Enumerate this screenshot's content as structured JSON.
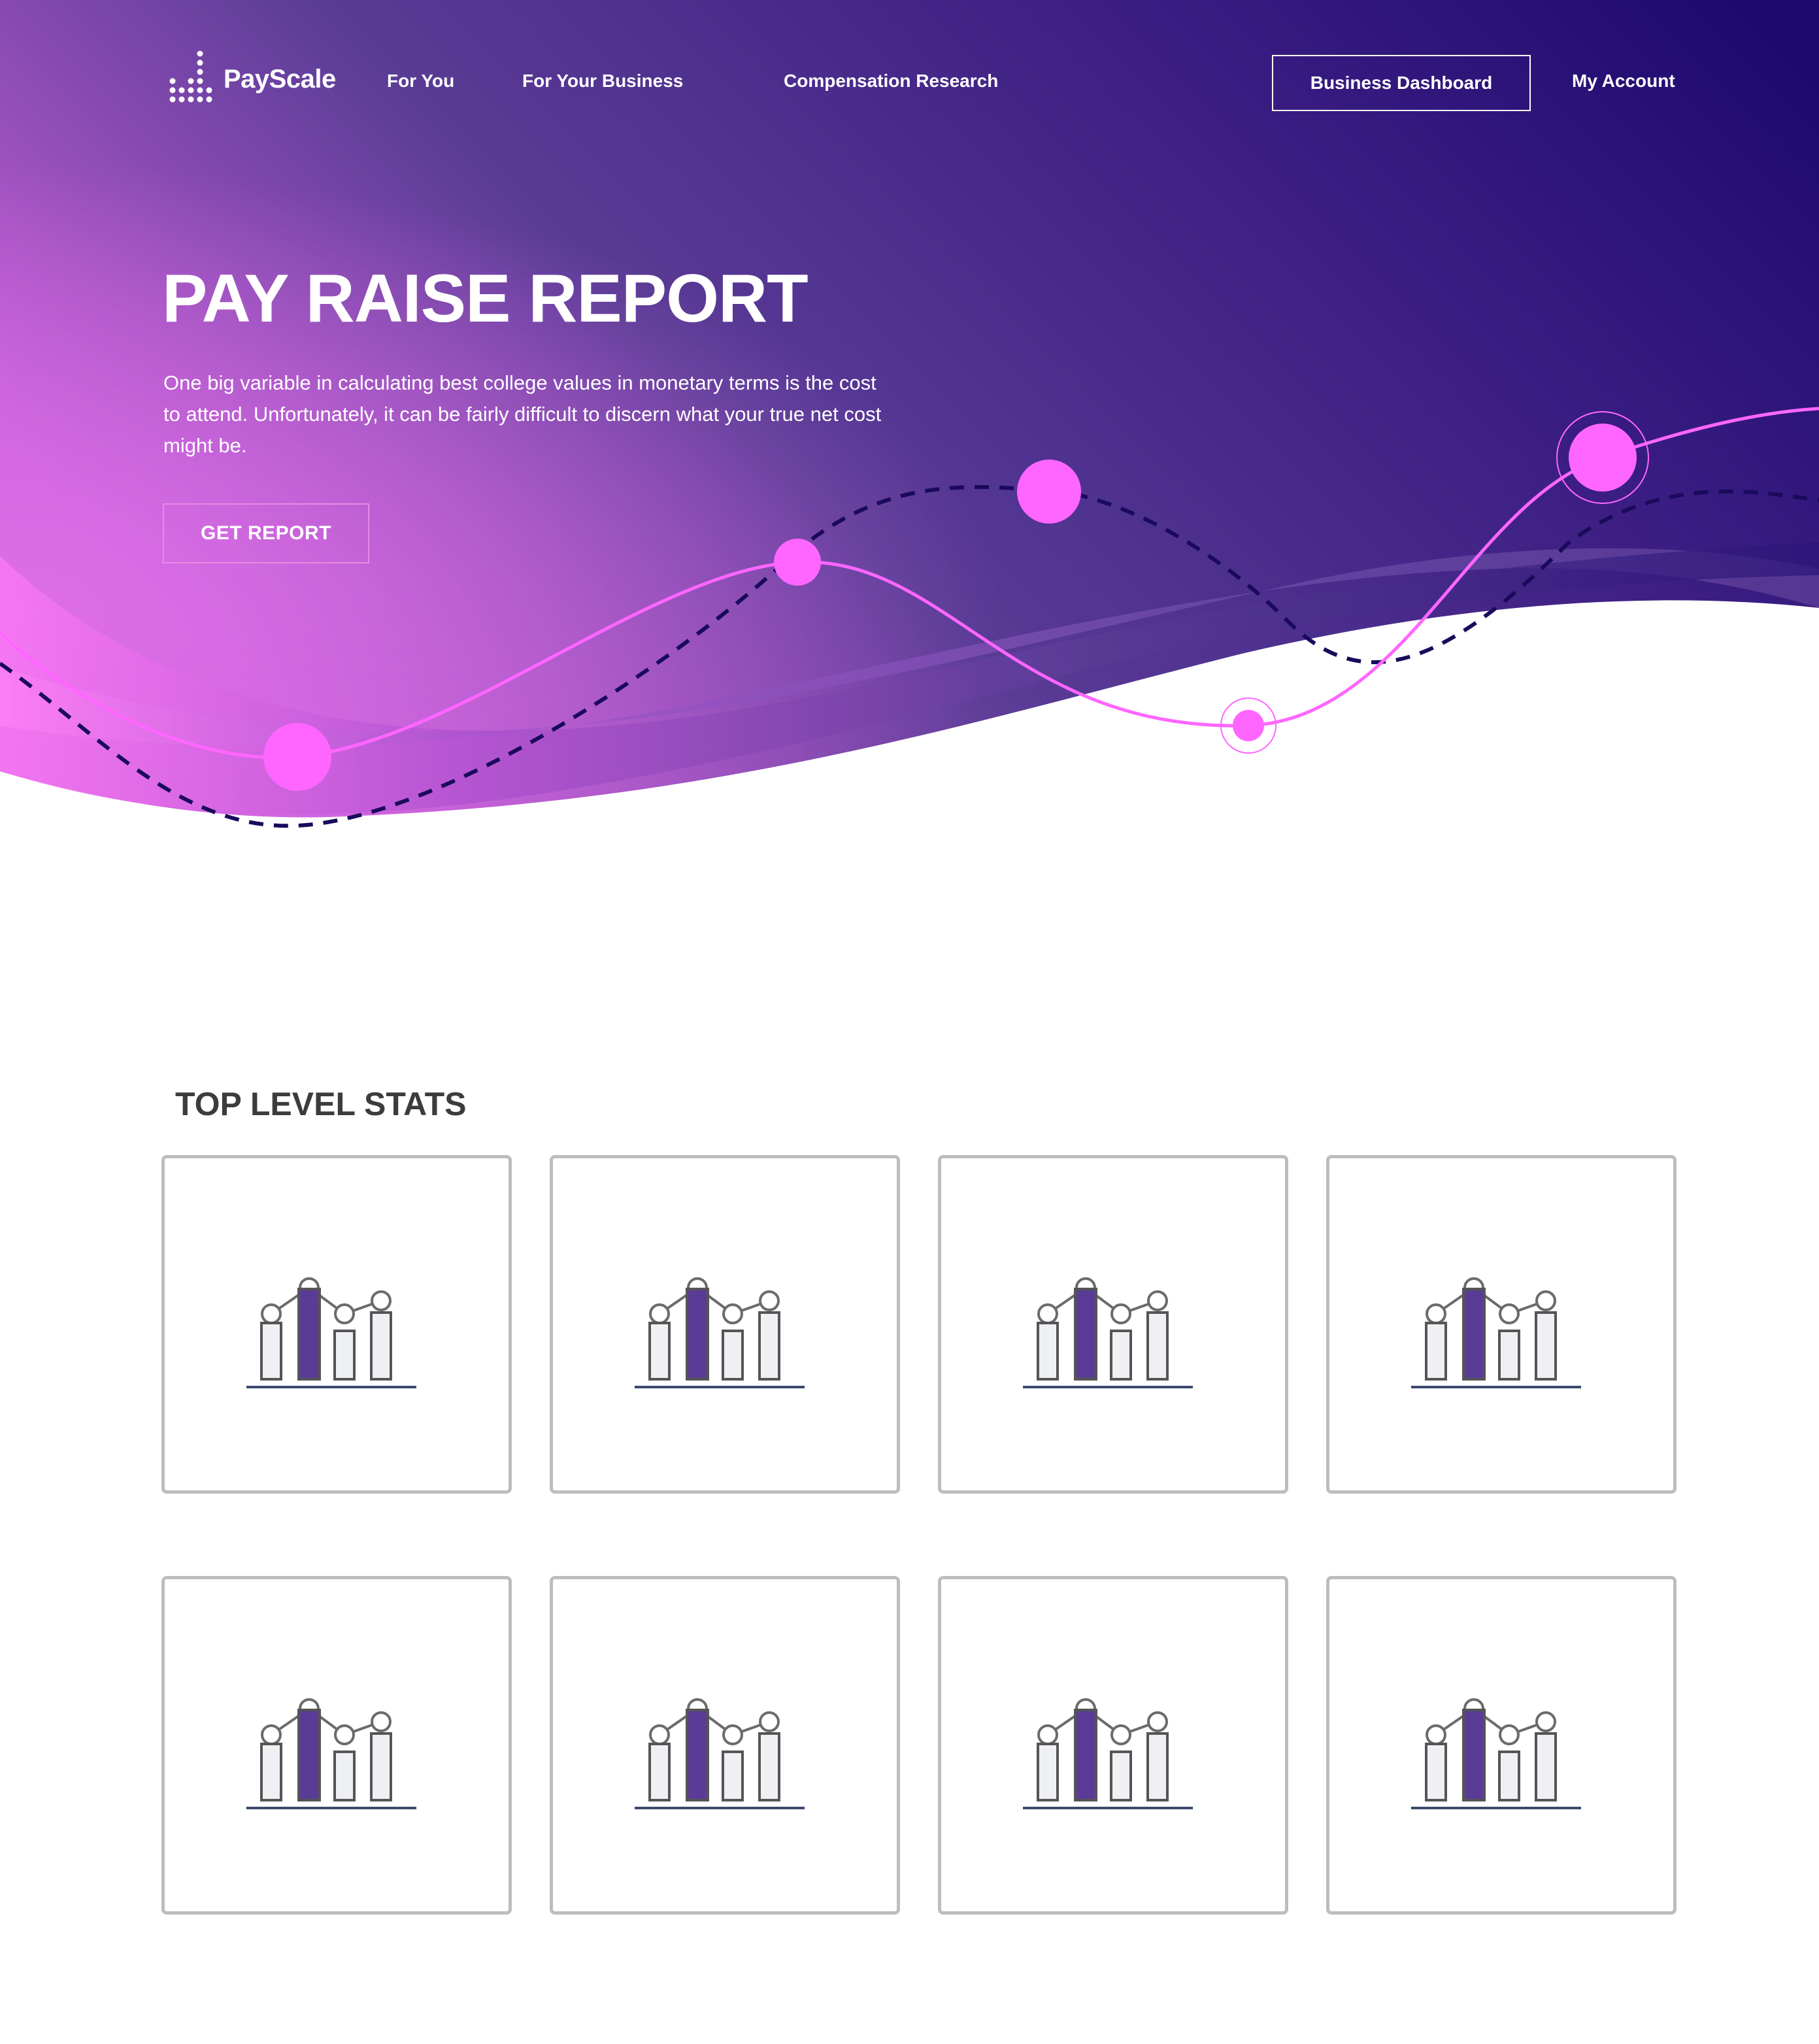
{
  "brand": {
    "name": "PayScale"
  },
  "nav": {
    "for_you": "For You",
    "for_business": "For Your Business",
    "compensation_research": "Compensation Research",
    "business_dashboard": "Business Dashboard",
    "my_account": "My Account"
  },
  "hero": {
    "title": "PAY RAISE REPORT",
    "description": "One big variable in calculating best college values in monetary terms is the cost to attend. Unfortunately, it can be fairly difficult to discern what your true net cost might be.",
    "cta_label": "GET REPORT"
  },
  "stats": {
    "title": "TOP LEVEL STATS",
    "cards": [
      {
        "icon": "chart-icon"
      },
      {
        "icon": "chart-icon"
      },
      {
        "icon": "chart-icon"
      },
      {
        "icon": "chart-icon"
      },
      {
        "icon": "chart-icon"
      },
      {
        "icon": "chart-icon"
      },
      {
        "icon": "chart-icon"
      },
      {
        "icon": "chart-icon"
      }
    ]
  },
  "colors": {
    "hero_gradient_start": "#c65ed8",
    "hero_gradient_mid": "#5a3c96",
    "hero_gradient_end": "#1e0a6e",
    "accent_pink": "#ff66ff",
    "dashed_line": "#1a0a5c",
    "card_border": "#bdbdbd",
    "icon_bar_fill": "#5a3c96",
    "icon_stroke": "#6b6b6b",
    "icon_baseline": "#3c4a6e",
    "heading_text": "#3c3c3c"
  }
}
